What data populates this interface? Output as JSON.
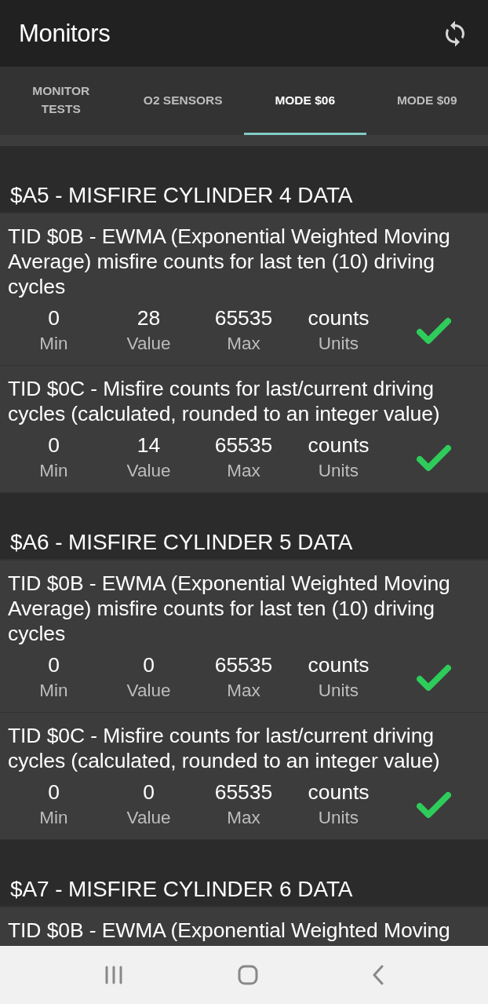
{
  "app_bar": {
    "title": "Monitors"
  },
  "tabs": [
    {
      "label": "MONITOR TESTS",
      "selected": false
    },
    {
      "label": "O2 SENSORS",
      "selected": false
    },
    {
      "label": "MODE $06",
      "selected": true
    },
    {
      "label": "MODE $09",
      "selected": false
    }
  ],
  "sections": [
    {
      "title": "$A5 - MISFIRE CYLINDER 4 DATA",
      "tests": [
        {
          "description": "TID $0B - EWMA (Exponential Weighted Moving Average) misfire counts for last ten (10) driving cycles",
          "stats": [
            {
              "value": "0",
              "label": "Min"
            },
            {
              "value": "28",
              "label": "Value"
            },
            {
              "value": "65535",
              "label": "Max"
            },
            {
              "value": "counts",
              "label": "Units"
            }
          ],
          "passed": true
        },
        {
          "description": "TID $0C - Misfire counts for last/current driving cycles (calculated, rounded to an integer value)",
          "stats": [
            {
              "value": "0",
              "label": "Min"
            },
            {
              "value": "14",
              "label": "Value"
            },
            {
              "value": "65535",
              "label": "Max"
            },
            {
              "value": "counts",
              "label": "Units"
            }
          ],
          "passed": true
        }
      ]
    },
    {
      "title": "$A6 - MISFIRE CYLINDER 5 DATA",
      "tests": [
        {
          "description": "TID $0B - EWMA (Exponential Weighted Moving Average) misfire counts for last ten (10) driving cycles",
          "stats": [
            {
              "value": "0",
              "label": "Min"
            },
            {
              "value": "0",
              "label": "Value"
            },
            {
              "value": "65535",
              "label": "Max"
            },
            {
              "value": "counts",
              "label": "Units"
            }
          ],
          "passed": true
        },
        {
          "description": "TID $0C - Misfire counts for last/current driving cycles (calculated, rounded to an integer value)",
          "stats": [
            {
              "value": "0",
              "label": "Min"
            },
            {
              "value": "0",
              "label": "Value"
            },
            {
              "value": "65535",
              "label": "Max"
            },
            {
              "value": "counts",
              "label": "Units"
            }
          ],
          "passed": true
        }
      ]
    },
    {
      "title": "$A7 - MISFIRE CYLINDER 6 DATA",
      "tests": [
        {
          "description": "TID $0B - EWMA (Exponential Weighted Moving"
        }
      ]
    }
  ]
}
